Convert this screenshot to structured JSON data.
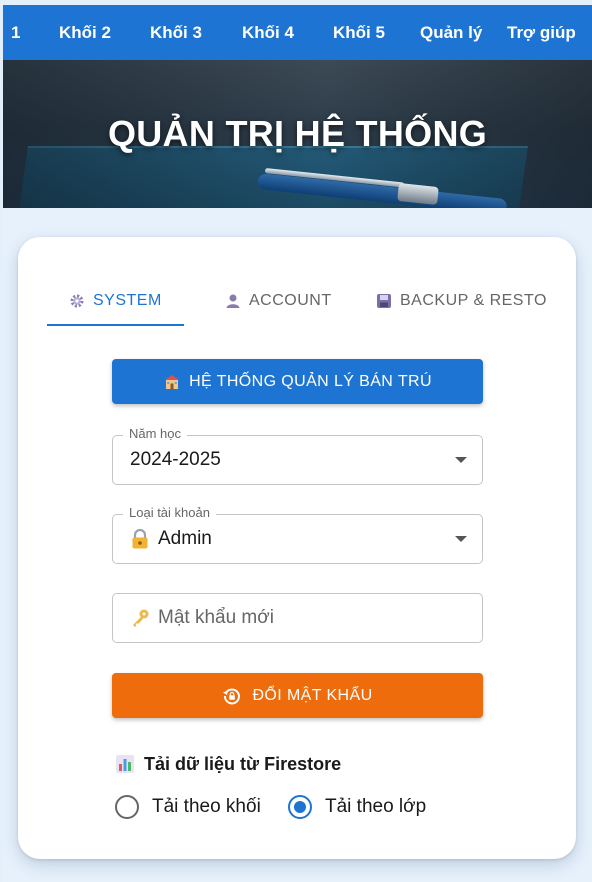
{
  "nav": {
    "items": [
      "1",
      "Khối 2",
      "Khối 3",
      "Khối 4",
      "Khối 5",
      "Quản lý",
      "Trợ giúp"
    ]
  },
  "hero": {
    "title": "QUẢN TRỊ HỆ THỐNG"
  },
  "tabs": [
    {
      "label": "SYSTEM",
      "icon": "gear-icon",
      "active": true
    },
    {
      "label": "ACCOUNT",
      "icon": "user-icon",
      "active": false
    },
    {
      "label": "BACKUP & RESTORE",
      "icon": "floppy-disk-icon",
      "active": false
    }
  ],
  "system_button": {
    "label": "HỆ THỐNG QUẢN LÝ BÁN TRÚ",
    "icon": "school-icon"
  },
  "school_year": {
    "label": "Năm học",
    "value": "2024-2025"
  },
  "account_type": {
    "label": "Loại tài khoản",
    "value": "Admin",
    "icon": "lock-icon"
  },
  "new_password": {
    "placeholder": "Mật khẩu mới",
    "icon": "key-icon"
  },
  "change_password_button": {
    "label": "ĐỔI MẬT KHẨU",
    "icon": "lock-reset-icon"
  },
  "load_section": {
    "title": "Tải dữ liệu từ Firestore",
    "icon": "bar-chart-icon",
    "options": [
      {
        "label": "Tải theo khối",
        "checked": false
      },
      {
        "label": "Tải theo lớp",
        "checked": true
      }
    ]
  },
  "colors": {
    "primary": "#1e74d3",
    "orange": "#ee6c0b",
    "page_background": "#e6f1fc"
  }
}
